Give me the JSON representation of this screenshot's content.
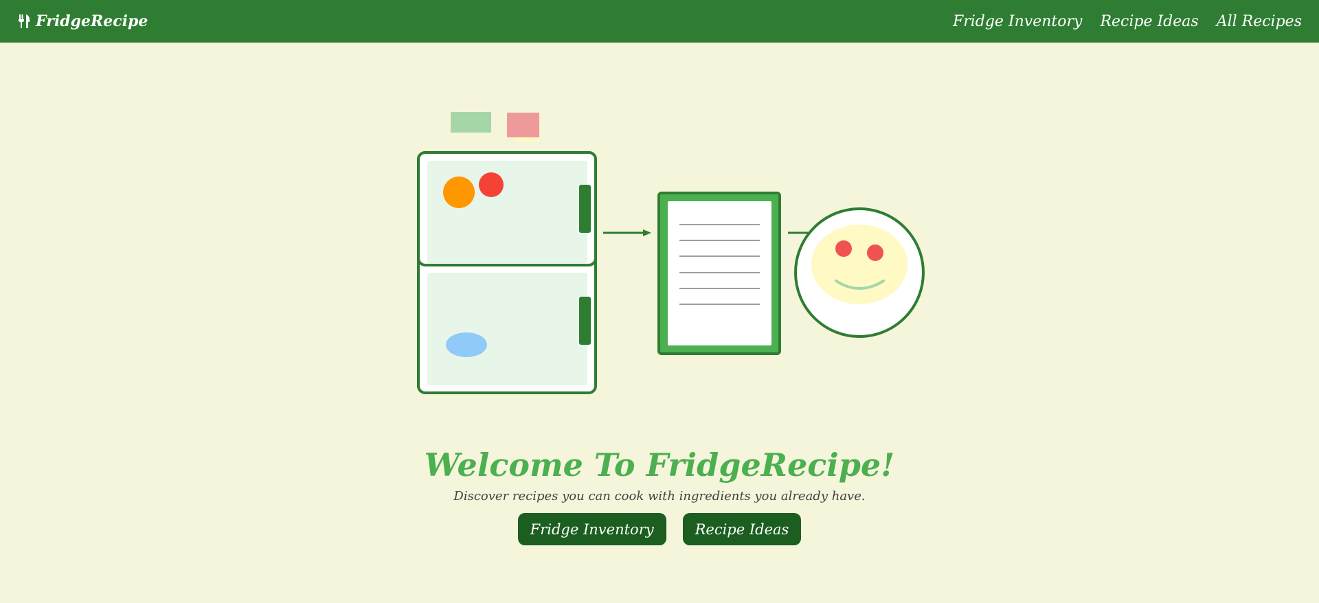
{
  "nav": {
    "brand": "FridgeRecipe",
    "brand_icon": "utensils-icon",
    "links": [
      "Fridge Inventory",
      "Recipe Ideas",
      "All Recipes"
    ]
  },
  "hero": {
    "title": "Welcome To FridgeRecipe!",
    "subtitle": "Discover recipes you can cook with ingredients you already have.",
    "buttons": [
      "Fridge Inventory",
      "Recipe Ideas"
    ]
  },
  "colors": {
    "nav_bg": "#2e7d32",
    "page_bg": "#f5f5dc",
    "accent": "#4caf50",
    "button_bg": "#1b5e20"
  }
}
